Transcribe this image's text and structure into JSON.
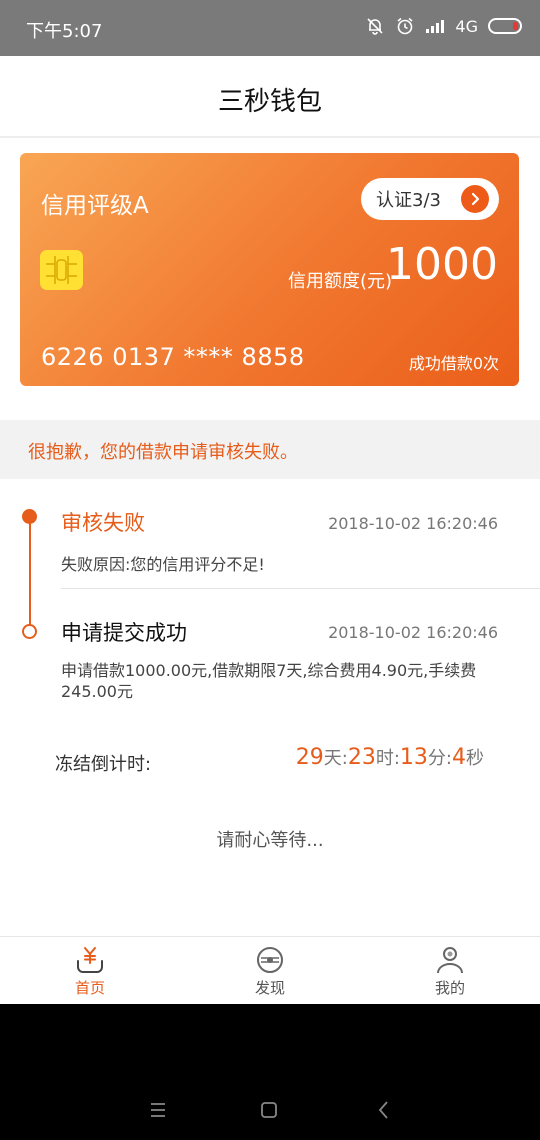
{
  "status_bar": {
    "time": "下午5:07",
    "network": "4G"
  },
  "header": {
    "title": "三秒钱包"
  },
  "card": {
    "rating": "信用评级A",
    "verify_label": "认证3/3",
    "credit_label": "信用额度(元)",
    "credit_value": "1000",
    "card_number": "6226 0137 **** 8858",
    "loan_count": "成功借款0次"
  },
  "alert": {
    "text": "很抱歉，您的借款申请审核失败。"
  },
  "timeline": [
    {
      "title": "审核失败",
      "time": "2018-10-02 16:20:46",
      "detail": "失败原因:您的信用评分不足!"
    },
    {
      "title": "申请提交成功",
      "time": "2018-10-02 16:20:46",
      "detail": "申请借款1000.00元,借款期限7天,综合费用4.90元,手续费245.00元"
    }
  ],
  "countdown": {
    "label": "冻结倒计时:",
    "days": "29",
    "days_unit": "天:",
    "hours": "23",
    "hours_unit": "时:",
    "minutes": "13",
    "minutes_unit": "分:",
    "seconds": "4",
    "seconds_unit": "秒"
  },
  "wait_text": "请耐心等待...",
  "tabs": [
    {
      "label": "首页",
      "icon": "yen-wallet-icon",
      "active": true
    },
    {
      "label": "发现",
      "icon": "discover-icon",
      "active": false
    },
    {
      "label": "我的",
      "icon": "user-icon",
      "active": false
    }
  ],
  "colors": {
    "accent": "#e65c1a",
    "card_start": "#f8a654",
    "card_end": "#ea5f1a",
    "chip": "#ffe033"
  }
}
